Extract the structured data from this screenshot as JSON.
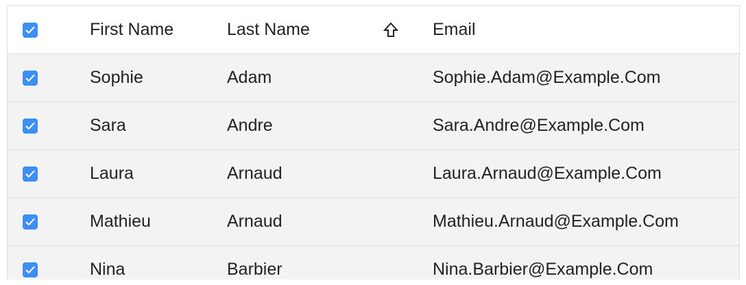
{
  "colors": {
    "checkbox_fill": "#3d8ff4",
    "row_background": "#f3f3f3",
    "header_background": "#ffffff"
  },
  "header": {
    "select_all_checked": true,
    "first_name": "First Name",
    "last_name": "Last Name",
    "sort_icon": "arrow-up-outline-icon",
    "email": "Email"
  },
  "rows": [
    {
      "checked": true,
      "first_name": "Sophie",
      "last_name": "Adam",
      "email": "Sophie.Adam@Example.Com"
    },
    {
      "checked": true,
      "first_name": "Sara",
      "last_name": "Andre",
      "email": "Sara.Andre@Example.Com"
    },
    {
      "checked": true,
      "first_name": "Laura",
      "last_name": "Arnaud",
      "email": "Laura.Arnaud@Example.Com"
    },
    {
      "checked": true,
      "first_name": "Mathieu",
      "last_name": "Arnaud",
      "email": "Mathieu.Arnaud@Example.Com"
    },
    {
      "checked": true,
      "first_name": "Nina",
      "last_name": "Barbier",
      "email": "Nina.Barbier@Example.Com"
    }
  ]
}
